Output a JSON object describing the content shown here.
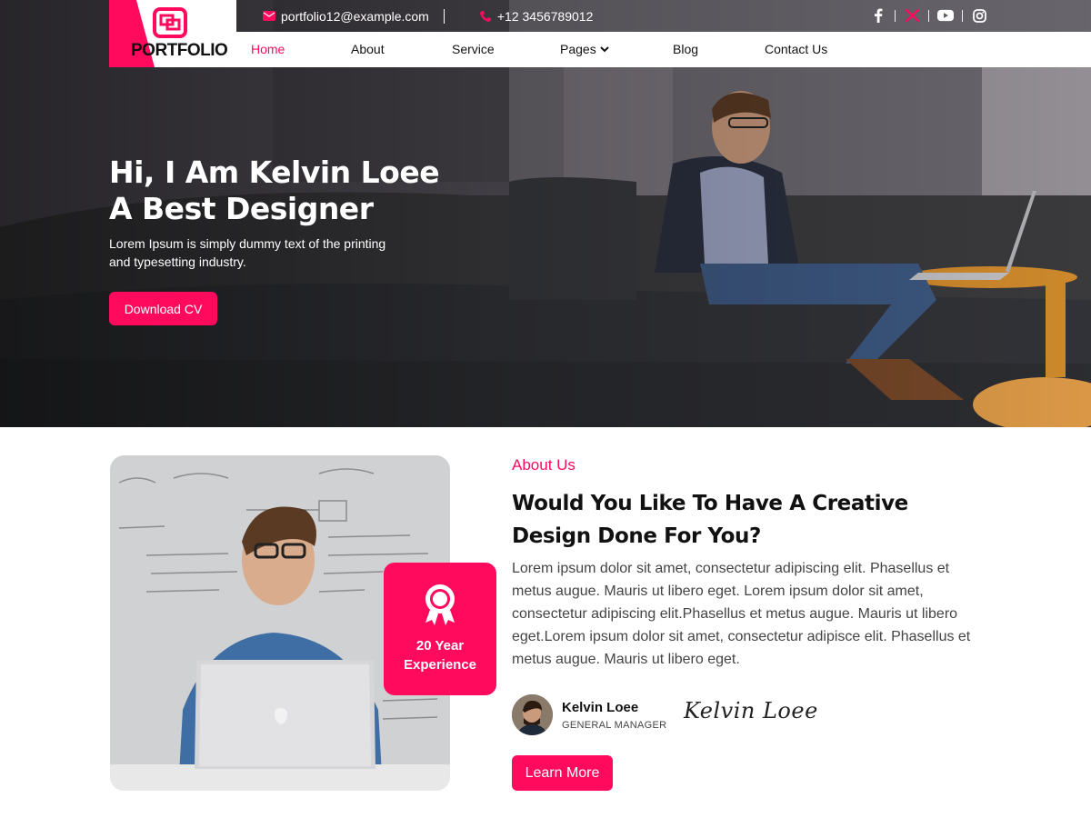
{
  "brand": {
    "logo_text": "PORTFOLIO",
    "accent_color": "#ff0a5c"
  },
  "topbar": {
    "email": "portfolio12@example.com",
    "phone": "+12 3456789012",
    "social_icons": [
      "facebook-icon",
      "x-icon",
      "youtube-icon",
      "instagram-icon"
    ]
  },
  "nav": {
    "items": [
      {
        "label": "Home",
        "active": true
      },
      {
        "label": "About"
      },
      {
        "label": "Service"
      },
      {
        "label": "Pages",
        "has_dropdown": true
      },
      {
        "label": "Blog"
      },
      {
        "label": "Contact Us"
      }
    ]
  },
  "hero": {
    "title_line1": "Hi, I Am Kelvin Loee",
    "title_line2": "A Best Designer",
    "subtitle": "Lorem Ipsum is simply dummy text of the printing and typesetting industry.",
    "cta_label": "Download CV"
  },
  "about": {
    "label": "About Us",
    "title": "Would You Like To Have A Creative Design Done For You?",
    "text": "Lorem ipsum dolor sit amet, consectetur adipiscing elit. Phasellus et metus augue. Mauris ut libero eget. Lorem ipsum dolor sit amet, consectetur adipiscing elit.Phasellus et metus augue. Mauris ut libero eget.Lorem ipsum dolor sit amet, consectetur adipisce elit. Phasellus et metus augue. Mauris ut libero eget.",
    "experience_line1": "20 Year",
    "experience_line2": "Experience",
    "person_name": "Kelvin Loee",
    "person_role": "GENERAL MANAGER",
    "signature": "Kelvin Loee",
    "cta_label": "Learn More"
  }
}
